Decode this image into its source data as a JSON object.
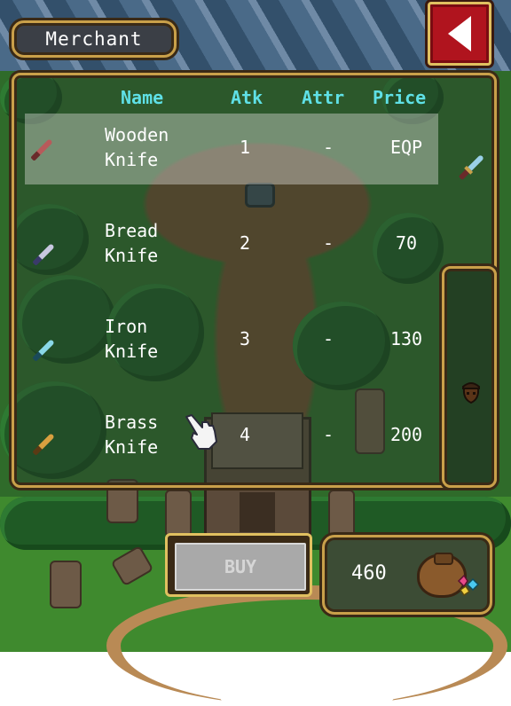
{
  "title": "Merchant",
  "table": {
    "headers": {
      "name": "Name",
      "atk": "Atk",
      "attr": "Attr",
      "price": "Price"
    },
    "rows": [
      {
        "name": "Wooden\nKnife",
        "atk": "1",
        "attr": "-",
        "price": "EQP",
        "icon": "wooden-knife-icon",
        "selected": true
      },
      {
        "name": "Bread\nKnife",
        "atk": "2",
        "attr": "-",
        "price": "70",
        "icon": "bread-knife-icon",
        "selected": false
      },
      {
        "name": "Iron\nKnife",
        "atk": "3",
        "attr": "-",
        "price": "130",
        "icon": "iron-knife-icon",
        "selected": false
      },
      {
        "name": "Brass\nKnife",
        "atk": "4",
        "attr": "-",
        "price": "200",
        "icon": "brass-knife-icon",
        "selected": false
      }
    ]
  },
  "buy_label": "BUY",
  "gold": "460",
  "colors": {
    "header": "#5fe0e6",
    "frame": "#c9a04a",
    "back_button": "#b0141e"
  }
}
